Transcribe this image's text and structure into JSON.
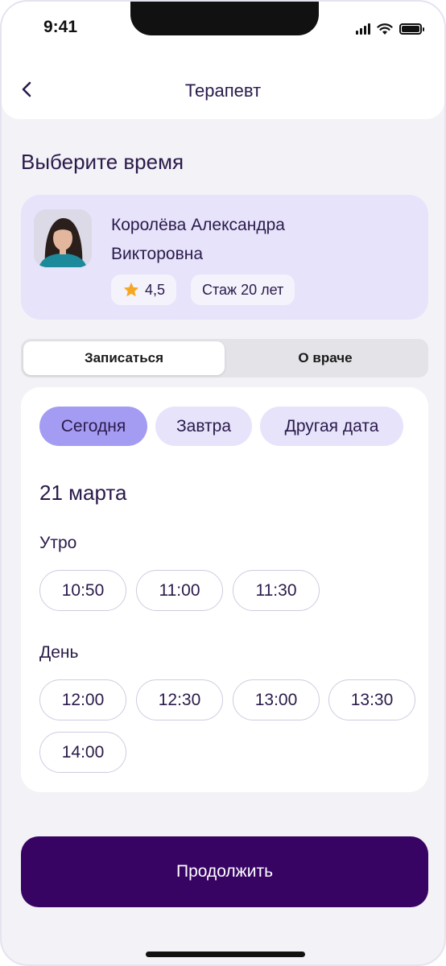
{
  "status_bar": {
    "time": "9:41",
    "icons": [
      "cellular-signal-icon",
      "wifi-icon",
      "battery-icon"
    ]
  },
  "header": {
    "back_icon": "chevron-left-icon",
    "title": "Терапевт"
  },
  "page_title": "Выберите время",
  "doctor": {
    "name_line1": "Королёва Александра",
    "name_line2": "Викторовна",
    "rating_icon": "star-icon",
    "rating": "4,5",
    "experience": "Стаж 20 лет"
  },
  "tabs": {
    "book": "Записаться",
    "about": "О враче",
    "active": "book"
  },
  "date_options": {
    "today": "Сегодня",
    "tomorrow": "Завтра",
    "other": "Другая дата",
    "selected": "today"
  },
  "selected_date": "21 марта",
  "morning": {
    "label": "Утро",
    "slots": [
      "10:50",
      "11:00",
      "11:30"
    ]
  },
  "day": {
    "label": "День",
    "slots": [
      "12:00",
      "12:30",
      "13:00",
      "13:30",
      "14:00"
    ]
  },
  "continue_label": "Продолжить",
  "colors": {
    "background": "#f3f2f7",
    "card_lavender": "#e7e3fb",
    "chip_active": "#a49cf3",
    "primary_button": "#370464",
    "text_primary": "#2a1a4a",
    "star": "#f5a623"
  }
}
